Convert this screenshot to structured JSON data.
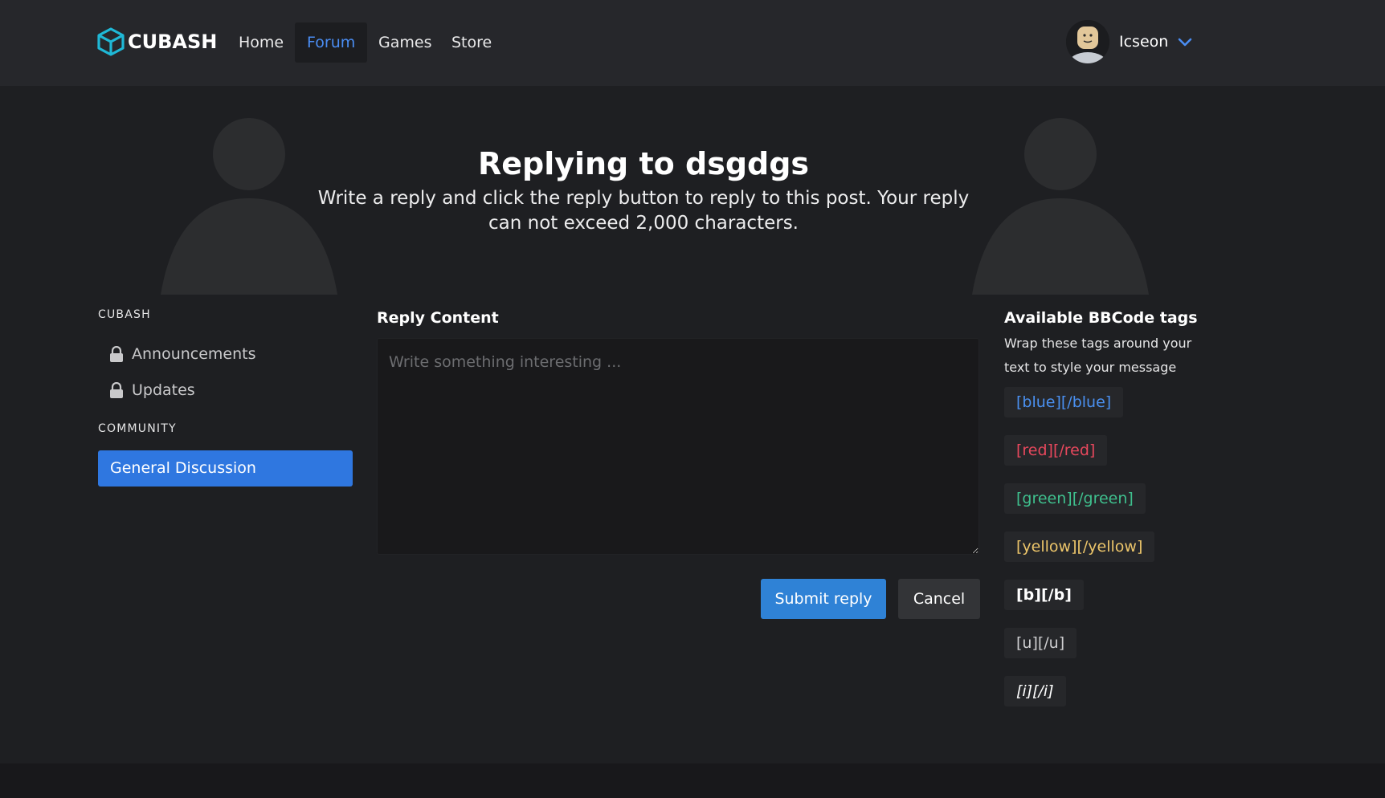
{
  "nav": {
    "brand": "CUBASH",
    "links": [
      "Home",
      "Forum",
      "Games",
      "Store"
    ],
    "active": "Forum",
    "username": "Icseon"
  },
  "hero": {
    "title": "Replying to dsgdgs",
    "subtitle": "Write a reply and click the reply button to reply to this post. Your reply can not exceed 2,000 characters."
  },
  "sidebar": {
    "sections": [
      {
        "heading": "CUBASH",
        "items": [
          "Announcements",
          "Updates"
        ]
      },
      {
        "heading": "COMMUNITY",
        "items": [
          "General Discussion"
        ]
      }
    ]
  },
  "form": {
    "label": "Reply Content",
    "placeholder": "Write something interesting ...",
    "value": "",
    "submit_label": "Submit reply",
    "cancel_label": "Cancel"
  },
  "bbcode": {
    "title": "Available BBCode tags",
    "description": "Wrap these tags around your text to style your message",
    "tags": [
      "[blue][/blue]",
      "[red][/red]",
      "[green][/green]",
      "[yellow][/yellow]",
      "[b][/b]",
      "[u][/u]",
      "[i][/i]"
    ]
  },
  "colors": {
    "accent": "#2f77e0",
    "submit": "#2f82d6",
    "active_nav": "#4a8df3",
    "logo": "#1fb8d6"
  }
}
